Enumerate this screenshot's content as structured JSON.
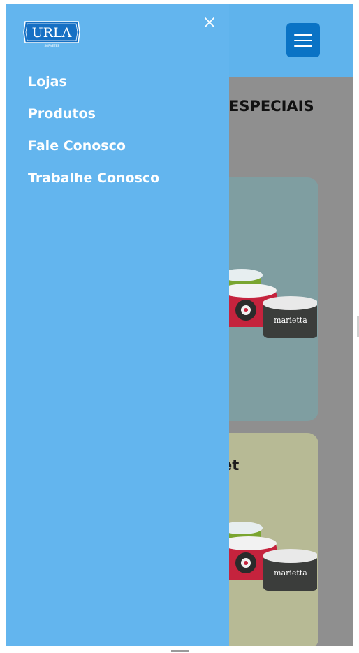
{
  "brand": {
    "logo_text": "URLA",
    "logo_subtext": "SORVETES"
  },
  "header": {
    "menu_icon": "hamburger-menu-icon",
    "menu_button_color": "#0a73c5"
  },
  "drawer": {
    "close_icon": "close-icon",
    "background_color": "#63b5ee",
    "items": [
      {
        "label": "Lojas"
      },
      {
        "label": "Produtos"
      },
      {
        "label": "Fale Conosco"
      },
      {
        "label": "Trabalhe Conosco"
      }
    ]
  },
  "page": {
    "section_title": "ESPECIAIS",
    "cards": [
      {
        "title": "",
        "image_text": "marietta"
      },
      {
        "title": "et",
        "image_text": "marietta"
      }
    ]
  }
}
